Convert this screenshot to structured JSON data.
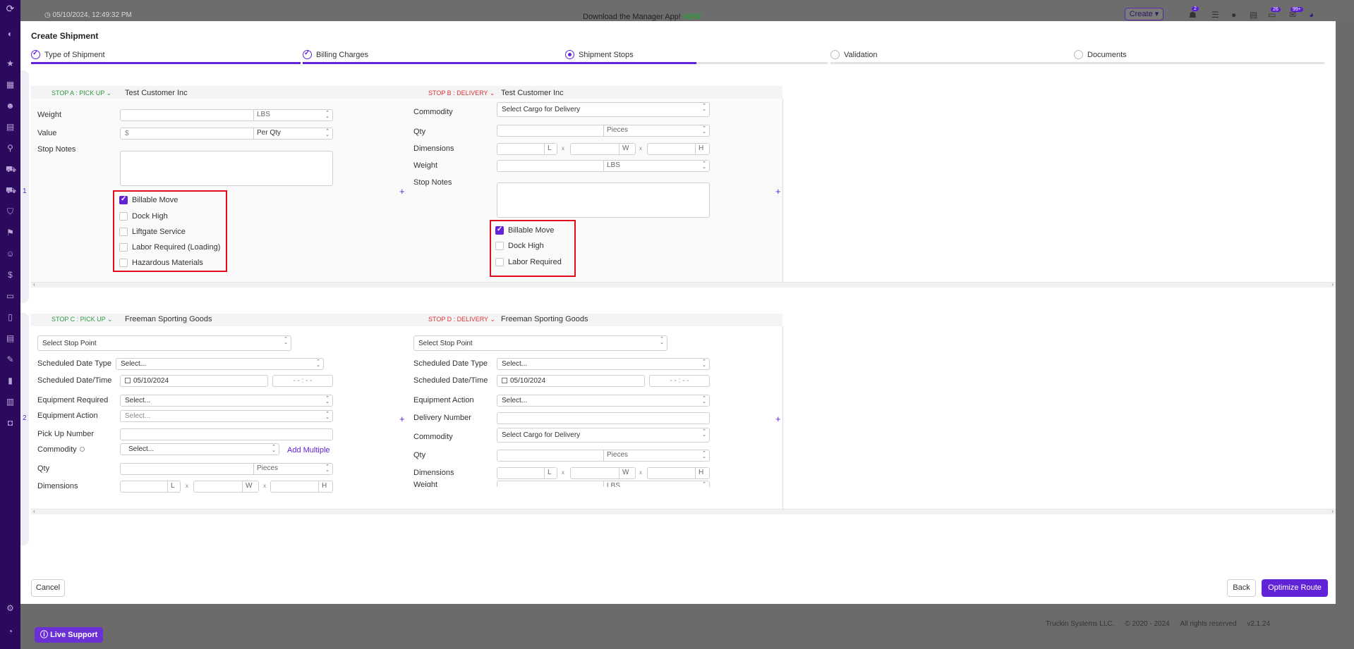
{
  "app": {
    "timestamp": "05/10/2024, 12:49:32 PM",
    "download_text": "Download the Manager App!",
    "download_new": "NEW",
    "create_label": "Create",
    "badges": [
      "2",
      "26",
      "99+"
    ],
    "footer": {
      "company": "Truckin Systems LLC.",
      "copyright": "© 2020 - 2024",
      "rights": "All rights reserved",
      "version": "v2.1.24"
    },
    "live_support": "Live Support"
  },
  "modal": {
    "title": "Create Shipment",
    "steps": [
      {
        "label": "Type of Shipment",
        "state": "done",
        "progress": 1.0
      },
      {
        "label": "Billing Charges",
        "state": "done",
        "progress": 1.0
      },
      {
        "label": "Shipment Stops",
        "state": "current",
        "progress": 0.5
      },
      {
        "label": "Validation",
        "state": "pending",
        "progress": 0
      },
      {
        "label": "Documents",
        "state": "pending",
        "progress": 0
      }
    ],
    "row1": {
      "number": "1",
      "stop_a": {
        "label": "STOP A : PICK UP",
        "customer": "Test Customer Inc",
        "weight_label": "Weight",
        "weight_unit": "LBS",
        "value_label": "Value",
        "value_placeholder": "$",
        "value_unit": "Per Qty",
        "notes_label": "Stop Notes",
        "checkboxes": [
          {
            "label": "Billable Move",
            "checked": true
          },
          {
            "label": "Dock High",
            "checked": false
          },
          {
            "label": "Liftgate Service",
            "checked": false
          },
          {
            "label": "Labor Required (Loading)",
            "checked": false
          },
          {
            "label": "Hazardous Materials",
            "checked": false
          }
        ]
      },
      "stop_b": {
        "label": "STOP B : DELIVERY",
        "customer": "Test Customer Inc",
        "commodity_label": "Commodity",
        "commodity_value": "Select Cargo for Delivery",
        "qty_label": "Qty",
        "qty_unit": "Pieces",
        "dimensions_label": "Dimensions",
        "dim_l": "L",
        "dim_w": "W",
        "dim_h": "H",
        "dim_x": "x",
        "weight_label": "Weight",
        "weight_unit": "LBS",
        "notes_label": "Stop Notes",
        "checkboxes": [
          {
            "label": "Billable Move",
            "checked": true
          },
          {
            "label": "Dock High",
            "checked": false
          },
          {
            "label": "Labor Required",
            "checked": false
          }
        ]
      }
    },
    "row2": {
      "number": "2",
      "stop_c": {
        "label": "STOP C : PICK UP",
        "customer": "Freeman Sporting Goods",
        "stop_point": "Select Stop Point",
        "sched_type_label": "Scheduled Date Type",
        "sched_type_value": "Select...",
        "sched_dt_label": "Scheduled Date/Time",
        "date": "05/10/2024",
        "time_placeholder": "- -   :   - -",
        "equip_req_label": "Equipment Required",
        "equip_req_value": "Select...",
        "equip_action_label": "Equipment Action",
        "equip_action_value": "Select...",
        "pickup_label": "Pick Up Number",
        "commodity_label": "Commodity",
        "commodity_value": "Select...",
        "add_multiple": "Add Multiple",
        "qty_label": "Qty",
        "qty_unit": "Pieces",
        "dimensions_label": "Dimensions",
        "dim_l": "L",
        "dim_w": "W",
        "dim_h": "H",
        "dim_x": "x"
      },
      "stop_d": {
        "label": "STOP D : DELIVERY",
        "customer": "Freeman Sporting Goods",
        "stop_point": "Select Stop Point",
        "sched_type_label": "Scheduled Date Type",
        "sched_type_value": "Select...",
        "sched_dt_label": "Scheduled Date/Time",
        "date": "05/10/2024",
        "time_placeholder": "- -   :   - -",
        "equip_action_label": "Equipment Action",
        "equip_action_value": "Select...",
        "delivery_label": "Delivery Number",
        "commodity_label": "Commodity",
        "commodity_value": "Select Cargo for Delivery",
        "qty_label": "Qty",
        "qty_unit": "Pieces",
        "dimensions_label": "Dimensions",
        "dim_l": "L",
        "dim_w": "W",
        "dim_h": "H",
        "dim_x": "x",
        "weight_label": "Weight",
        "weight_unit": "LBS"
      }
    },
    "buttons": {
      "cancel": "Cancel",
      "back": "Back",
      "optimize": "Optimize Route"
    }
  }
}
